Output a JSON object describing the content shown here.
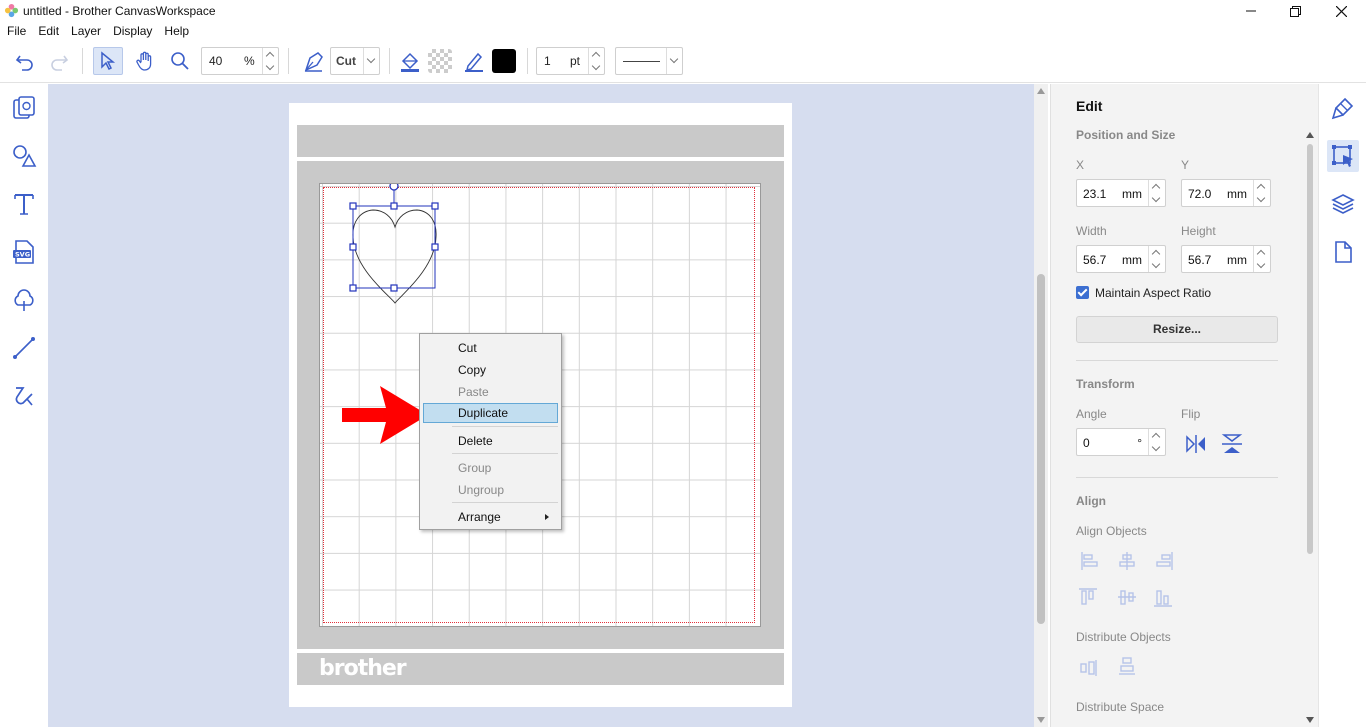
{
  "window": {
    "title": "untitled - Brother CanvasWorkspace"
  },
  "menu": [
    "File",
    "Edit",
    "Layer",
    "Display",
    "Help"
  ],
  "toolbar": {
    "zoom_value": "40",
    "zoom_unit": "%",
    "mode_label": "Cut",
    "line_width_value": "1",
    "line_width_unit": "pt",
    "stroke_color": "#000000"
  },
  "canvas": {
    "brand_logo": "brother"
  },
  "context_menu": {
    "items": [
      {
        "label": "Cut",
        "enabled": true
      },
      {
        "label": "Copy",
        "enabled": true
      },
      {
        "label": "Paste",
        "enabled": false
      },
      {
        "label": "Duplicate",
        "enabled": true,
        "highlighted": true
      },
      {
        "label": "Delete",
        "enabled": true
      },
      {
        "label": "Group",
        "enabled": false
      },
      {
        "label": "Ungroup",
        "enabled": false
      },
      {
        "label": "Arrange",
        "enabled": true,
        "submenu": true
      }
    ]
  },
  "edit_panel": {
    "title": "Edit",
    "position_size_heading": "Position and Size",
    "x_label": "X",
    "x_value": "23.1",
    "y_label": "Y",
    "y_value": "72.0",
    "width_label": "Width",
    "width_value": "56.7",
    "height_label": "Height",
    "height_value": "56.7",
    "unit": "mm",
    "maintain_aspect_label": "Maintain Aspect Ratio",
    "maintain_aspect_checked": true,
    "resize_button": "Resize...",
    "transform_heading": "Transform",
    "angle_label": "Angle",
    "angle_value": "0",
    "angle_unit": "°",
    "flip_label": "Flip",
    "align_heading": "Align",
    "align_objects_label": "Align Objects",
    "distribute_objects_label": "Distribute Objects",
    "distribute_space_label": "Distribute Space"
  },
  "colors": {
    "accent": "#3c5fc9",
    "workspace_bg": "#d6ddef",
    "highlight": "#c2def0",
    "annotation_arrow": "#ff0000"
  }
}
